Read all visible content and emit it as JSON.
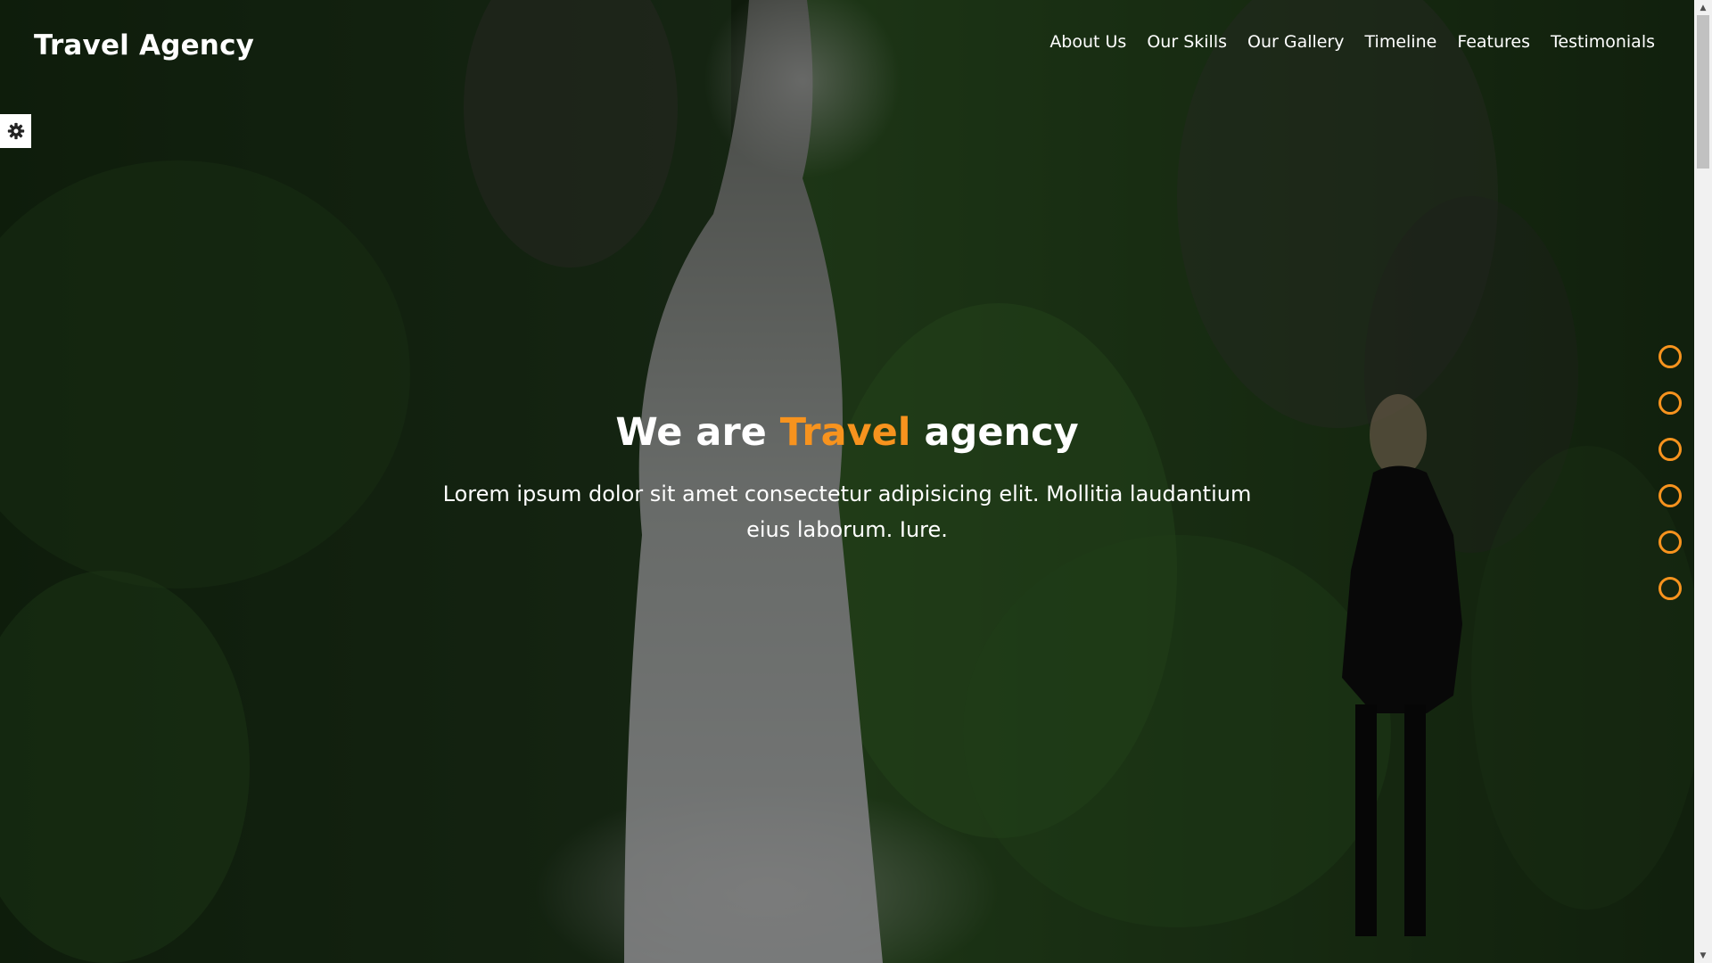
{
  "brand": {
    "name": "Travel Agency"
  },
  "nav": {
    "items": [
      {
        "label": "About Us"
      },
      {
        "label": "Our Skills"
      },
      {
        "label": "Our Gallery"
      },
      {
        "label": "Timeline"
      },
      {
        "label": "Features"
      },
      {
        "label": "Testimonials"
      }
    ]
  },
  "settings": {
    "icon": "gear-icon"
  },
  "hero": {
    "title_before": "We are ",
    "title_accent": "Travel",
    "title_after": " agency",
    "text": "Lorem ipsum dolor sit amet consectetur adipisicing elit. Mollitia laudantium eius laborum. Iure."
  },
  "bullets": {
    "count": 6
  },
  "colors": {
    "accent": "#f7931e",
    "text": "#ffffff",
    "overlay": "rgba(0,0,0,0.5)"
  }
}
